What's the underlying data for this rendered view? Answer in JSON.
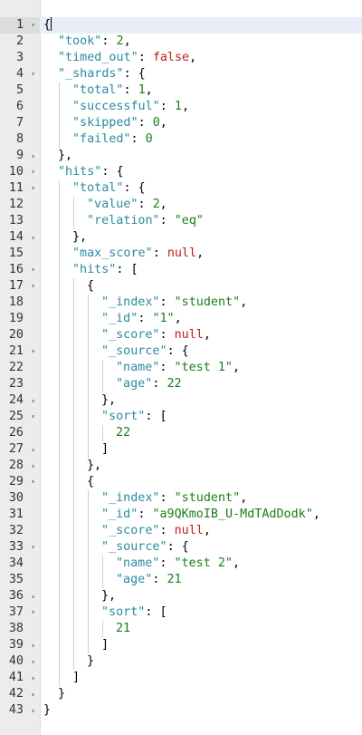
{
  "editor": {
    "lines": [
      {
        "n": "1",
        "fold": "▾",
        "depth": 0,
        "tokens": [
          {
            "t": "p",
            "v": "{"
          }
        ],
        "cursor": true
      },
      {
        "n": "2",
        "fold": "",
        "depth": 1,
        "tokens": [
          {
            "t": "k",
            "v": "\"took\""
          },
          {
            "t": "p",
            "v": ": "
          },
          {
            "t": "n",
            "v": "2"
          },
          {
            "t": "p",
            "v": ","
          }
        ]
      },
      {
        "n": "3",
        "fold": "",
        "depth": 1,
        "tokens": [
          {
            "t": "k",
            "v": "\"timed_out\""
          },
          {
            "t": "p",
            "v": ": "
          },
          {
            "t": "c",
            "v": "false"
          },
          {
            "t": "p",
            "v": ","
          }
        ]
      },
      {
        "n": "4",
        "fold": "▾",
        "depth": 1,
        "tokens": [
          {
            "t": "k",
            "v": "\"_shards\""
          },
          {
            "t": "p",
            "v": ": {"
          }
        ]
      },
      {
        "n": "5",
        "fold": "",
        "depth": 2,
        "tokens": [
          {
            "t": "k",
            "v": "\"total\""
          },
          {
            "t": "p",
            "v": ": "
          },
          {
            "t": "n",
            "v": "1"
          },
          {
            "t": "p",
            "v": ","
          }
        ]
      },
      {
        "n": "6",
        "fold": "",
        "depth": 2,
        "tokens": [
          {
            "t": "k",
            "v": "\"successful\""
          },
          {
            "t": "p",
            "v": ": "
          },
          {
            "t": "n",
            "v": "1"
          },
          {
            "t": "p",
            "v": ","
          }
        ]
      },
      {
        "n": "7",
        "fold": "",
        "depth": 2,
        "tokens": [
          {
            "t": "k",
            "v": "\"skipped\""
          },
          {
            "t": "p",
            "v": ": "
          },
          {
            "t": "n",
            "v": "0"
          },
          {
            "t": "p",
            "v": ","
          }
        ]
      },
      {
        "n": "8",
        "fold": "",
        "depth": 2,
        "tokens": [
          {
            "t": "k",
            "v": "\"failed\""
          },
          {
            "t": "p",
            "v": ": "
          },
          {
            "t": "n",
            "v": "0"
          }
        ]
      },
      {
        "n": "9",
        "fold": "▴",
        "depth": 1,
        "tokens": [
          {
            "t": "p",
            "v": "},"
          }
        ]
      },
      {
        "n": "10",
        "fold": "▾",
        "depth": 1,
        "tokens": [
          {
            "t": "k",
            "v": "\"hits\""
          },
          {
            "t": "p",
            "v": ": {"
          }
        ]
      },
      {
        "n": "11",
        "fold": "▾",
        "depth": 2,
        "tokens": [
          {
            "t": "k",
            "v": "\"total\""
          },
          {
            "t": "p",
            "v": ": {"
          }
        ]
      },
      {
        "n": "12",
        "fold": "",
        "depth": 3,
        "tokens": [
          {
            "t": "k",
            "v": "\"value\""
          },
          {
            "t": "p",
            "v": ": "
          },
          {
            "t": "n",
            "v": "2"
          },
          {
            "t": "p",
            "v": ","
          }
        ]
      },
      {
        "n": "13",
        "fold": "",
        "depth": 3,
        "tokens": [
          {
            "t": "k",
            "v": "\"relation\""
          },
          {
            "t": "p",
            "v": ": "
          },
          {
            "t": "s",
            "v": "\"eq\""
          }
        ]
      },
      {
        "n": "14",
        "fold": "▴",
        "depth": 2,
        "tokens": [
          {
            "t": "p",
            "v": "},"
          }
        ]
      },
      {
        "n": "15",
        "fold": "",
        "depth": 2,
        "tokens": [
          {
            "t": "k",
            "v": "\"max_score\""
          },
          {
            "t": "p",
            "v": ": "
          },
          {
            "t": "c",
            "v": "null"
          },
          {
            "t": "p",
            "v": ","
          }
        ]
      },
      {
        "n": "16",
        "fold": "▾",
        "depth": 2,
        "tokens": [
          {
            "t": "k",
            "v": "\"hits\""
          },
          {
            "t": "p",
            "v": ": ["
          }
        ]
      },
      {
        "n": "17",
        "fold": "▾",
        "depth": 3,
        "tokens": [
          {
            "t": "p",
            "v": "{"
          }
        ]
      },
      {
        "n": "18",
        "fold": "",
        "depth": 4,
        "tokens": [
          {
            "t": "k",
            "v": "\"_index\""
          },
          {
            "t": "p",
            "v": ": "
          },
          {
            "t": "s",
            "v": "\"student\""
          },
          {
            "t": "p",
            "v": ","
          }
        ]
      },
      {
        "n": "19",
        "fold": "",
        "depth": 4,
        "tokens": [
          {
            "t": "k",
            "v": "\"_id\""
          },
          {
            "t": "p",
            "v": ": "
          },
          {
            "t": "s",
            "v": "\"1\""
          },
          {
            "t": "p",
            "v": ","
          }
        ]
      },
      {
        "n": "20",
        "fold": "",
        "depth": 4,
        "tokens": [
          {
            "t": "k",
            "v": "\"_score\""
          },
          {
            "t": "p",
            "v": ": "
          },
          {
            "t": "c",
            "v": "null"
          },
          {
            "t": "p",
            "v": ","
          }
        ]
      },
      {
        "n": "21",
        "fold": "▾",
        "depth": 4,
        "tokens": [
          {
            "t": "k",
            "v": "\"_source\""
          },
          {
            "t": "p",
            "v": ": {"
          }
        ]
      },
      {
        "n": "22",
        "fold": "",
        "depth": 5,
        "tokens": [
          {
            "t": "k",
            "v": "\"name\""
          },
          {
            "t": "p",
            "v": ": "
          },
          {
            "t": "s",
            "v": "\"test 1\""
          },
          {
            "t": "p",
            "v": ","
          }
        ]
      },
      {
        "n": "23",
        "fold": "",
        "depth": 5,
        "tokens": [
          {
            "t": "k",
            "v": "\"age\""
          },
          {
            "t": "p",
            "v": ": "
          },
          {
            "t": "n",
            "v": "22"
          }
        ]
      },
      {
        "n": "24",
        "fold": "▴",
        "depth": 4,
        "tokens": [
          {
            "t": "p",
            "v": "},"
          }
        ]
      },
      {
        "n": "25",
        "fold": "▾",
        "depth": 4,
        "tokens": [
          {
            "t": "k",
            "v": "\"sort\""
          },
          {
            "t": "p",
            "v": ": ["
          }
        ]
      },
      {
        "n": "26",
        "fold": "",
        "depth": 5,
        "tokens": [
          {
            "t": "n",
            "v": "22"
          }
        ]
      },
      {
        "n": "27",
        "fold": "▴",
        "depth": 4,
        "tokens": [
          {
            "t": "p",
            "v": "]"
          }
        ]
      },
      {
        "n": "28",
        "fold": "▴",
        "depth": 3,
        "tokens": [
          {
            "t": "p",
            "v": "},"
          }
        ]
      },
      {
        "n": "29",
        "fold": "▾",
        "depth": 3,
        "tokens": [
          {
            "t": "p",
            "v": "{"
          }
        ]
      },
      {
        "n": "30",
        "fold": "",
        "depth": 4,
        "tokens": [
          {
            "t": "k",
            "v": "\"_index\""
          },
          {
            "t": "p",
            "v": ": "
          },
          {
            "t": "s",
            "v": "\"student\""
          },
          {
            "t": "p",
            "v": ","
          }
        ]
      },
      {
        "n": "31",
        "fold": "",
        "depth": 4,
        "tokens": [
          {
            "t": "k",
            "v": "\"_id\""
          },
          {
            "t": "p",
            "v": ": "
          },
          {
            "t": "s",
            "v": "\"a9QKmoIB_U-MdTAdDodk\""
          },
          {
            "t": "p",
            "v": ","
          }
        ]
      },
      {
        "n": "32",
        "fold": "",
        "depth": 4,
        "tokens": [
          {
            "t": "k",
            "v": "\"_score\""
          },
          {
            "t": "p",
            "v": ": "
          },
          {
            "t": "c",
            "v": "null"
          },
          {
            "t": "p",
            "v": ","
          }
        ]
      },
      {
        "n": "33",
        "fold": "▾",
        "depth": 4,
        "tokens": [
          {
            "t": "k",
            "v": "\"_source\""
          },
          {
            "t": "p",
            "v": ": {"
          }
        ]
      },
      {
        "n": "34",
        "fold": "",
        "depth": 5,
        "tokens": [
          {
            "t": "k",
            "v": "\"name\""
          },
          {
            "t": "p",
            "v": ": "
          },
          {
            "t": "s",
            "v": "\"test 2\""
          },
          {
            "t": "p",
            "v": ","
          }
        ]
      },
      {
        "n": "35",
        "fold": "",
        "depth": 5,
        "tokens": [
          {
            "t": "k",
            "v": "\"age\""
          },
          {
            "t": "p",
            "v": ": "
          },
          {
            "t": "n",
            "v": "21"
          }
        ]
      },
      {
        "n": "36",
        "fold": "▴",
        "depth": 4,
        "tokens": [
          {
            "t": "p",
            "v": "},"
          }
        ]
      },
      {
        "n": "37",
        "fold": "▾",
        "depth": 4,
        "tokens": [
          {
            "t": "k",
            "v": "\"sort\""
          },
          {
            "t": "p",
            "v": ": ["
          }
        ]
      },
      {
        "n": "38",
        "fold": "",
        "depth": 5,
        "tokens": [
          {
            "t": "n",
            "v": "21"
          }
        ]
      },
      {
        "n": "39",
        "fold": "▴",
        "depth": 4,
        "tokens": [
          {
            "t": "p",
            "v": "]"
          }
        ]
      },
      {
        "n": "40",
        "fold": "▴",
        "depth": 3,
        "tokens": [
          {
            "t": "p",
            "v": "}"
          }
        ]
      },
      {
        "n": "41",
        "fold": "▴",
        "depth": 2,
        "tokens": [
          {
            "t": "p",
            "v": "]"
          }
        ]
      },
      {
        "n": "42",
        "fold": "▴",
        "depth": 1,
        "tokens": [
          {
            "t": "p",
            "v": "}"
          }
        ]
      },
      {
        "n": "43",
        "fold": "▴",
        "depth": 0,
        "tokens": [
          {
            "t": "p",
            "v": "}"
          }
        ]
      }
    ],
    "colors": {
      "key": "#2a8ba0",
      "string": "#1a7f1a",
      "number": "#1a7f1a",
      "constant": "#c41a16",
      "gutter": "#ececec",
      "active_line": "#e8eef8"
    },
    "icons": {
      "fold_open": "fold-open-icon",
      "fold_close": "fold-close-icon"
    }
  }
}
